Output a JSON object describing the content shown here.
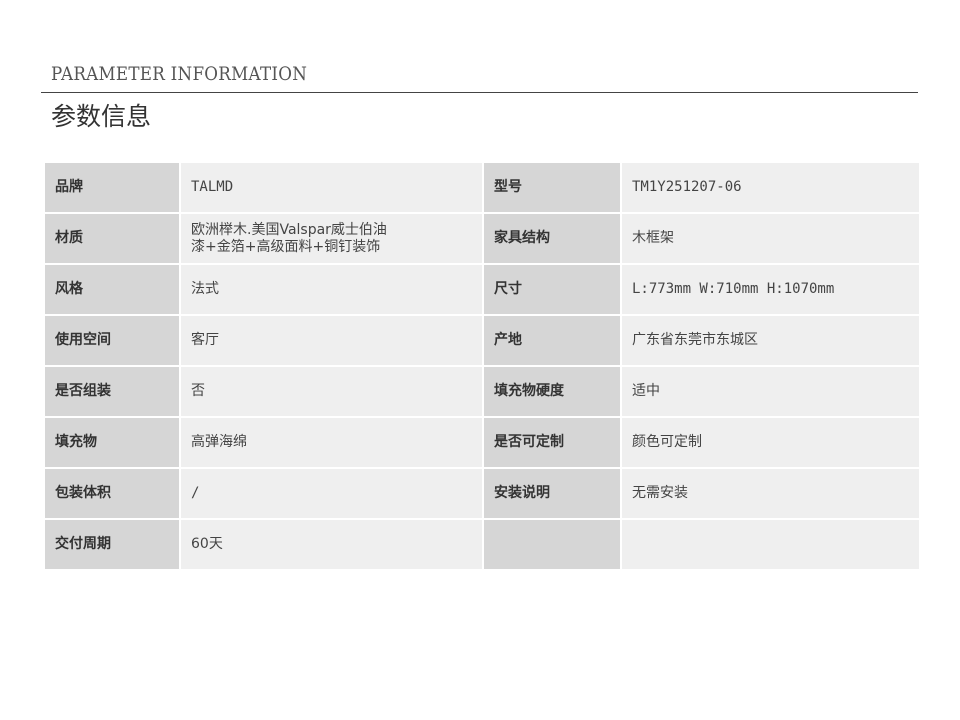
{
  "header": {
    "title_en": "PARAMETER INFORMATION",
    "title_cn": "参数信息"
  },
  "params": {
    "brand_label": "品牌",
    "brand_value": "TALMD",
    "model_label": "型号",
    "model_value": "TM1Y251207-06",
    "material_label": "材质",
    "material_value_line1": "欧洲榉木.美国Valspar威士伯油",
    "material_value_line2": "漆+金箔+高级面料+铜钉装饰",
    "structure_label": "家具结构",
    "structure_value": "木框架",
    "style_label": "风格",
    "style_value": "法式",
    "size_label": "尺寸",
    "size_value": "L:773mm W:710mm H:1070mm",
    "space_label": "使用空间",
    "space_value": "客厅",
    "origin_label": "产地",
    "origin_value": "广东省东莞市东城区",
    "assembly_label": "是否组装",
    "assembly_value": "否",
    "hardness_label": "填充物硬度",
    "hardness_value": "适中",
    "filling_label": "填充物",
    "filling_value": "高弹海绵",
    "custom_label": "是否可定制",
    "custom_value": "颜色可定制",
    "package_label": "包装体积",
    "package_value": "/",
    "install_label": "安装说明",
    "install_value": "无需安装",
    "delivery_label": "交付周期",
    "delivery_value": "60天"
  },
  "colors": {
    "label_bg": "#d6d6d6",
    "value_bg": "#efefef",
    "rule": "#444444"
  }
}
